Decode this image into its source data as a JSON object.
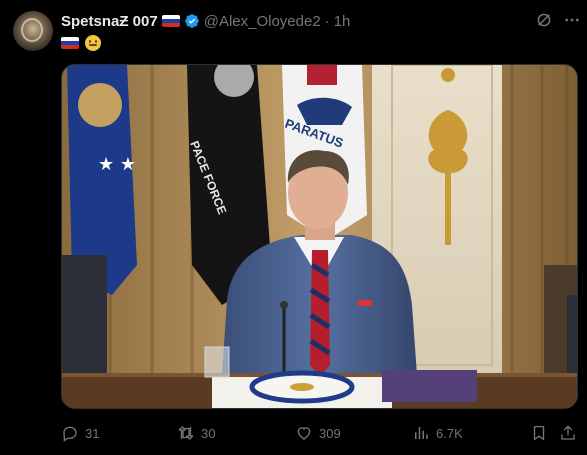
{
  "post": {
    "author": {
      "display_name": "SpetsnaƵ 007",
      "handle": "@Alex_Oloyede2",
      "time": "1h",
      "separator": "·",
      "verified": true
    },
    "bio_emojis": [
      "russia-flag",
      "saluting-face"
    ],
    "media": {
      "description_icon": "photo",
      "flag_text_1": "PACE FORCE",
      "flag_text_2": "PARATUS"
    },
    "actions": {
      "replies": "31",
      "reposts": "30",
      "likes": "309",
      "views": "6.7K"
    }
  },
  "colors": {
    "background": "#000000",
    "text_primary": "#e7e9ea",
    "text_secondary": "#71767b",
    "verified_blue": "#1d9bf0"
  }
}
